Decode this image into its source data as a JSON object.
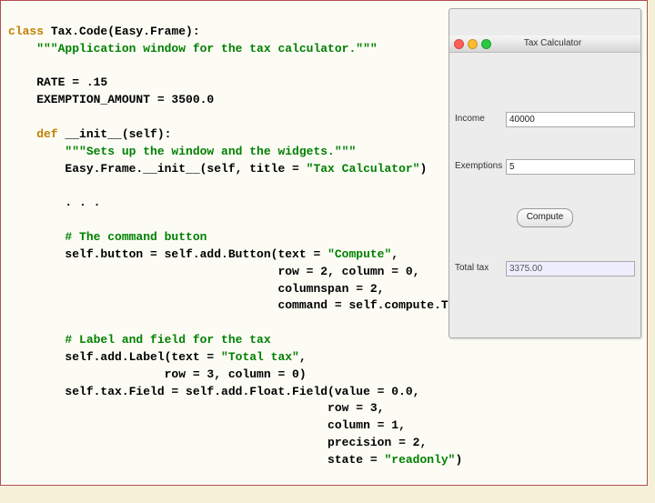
{
  "code": {
    "l1a": "class",
    "l1b": " Tax.Code(Easy.Frame):",
    "l2": "    \"\"\"Application window for the tax calculator.\"\"\"",
    "l3": "",
    "l4": "    RATE = .15",
    "l5": "    EXEMPTION_AMOUNT = 3500.0",
    "l6": "",
    "l7a": "    def",
    "l7b": " __init__(self):",
    "l8": "        \"\"\"Sets up the window and the widgets.\"\"\"",
    "l9a": "        Easy.Frame.__init__(self, title = ",
    "l9b": "\"Tax Calculator\"",
    "l9c": ")",
    "l10": "",
    "l11": "        . . .",
    "l12": "",
    "l13": "        # The command button",
    "l14a": "        self.button = self.add.Button(text = ",
    "l14b": "\"Compute\"",
    "l14c": ",",
    "l15": "                                      row = 2, column = 0,",
    "l16": "                                      columnspan = 2,",
    "l17": "                                      command = self.compute.Tax)",
    "l18": "",
    "l19": "        # Label and field for the tax",
    "l20a": "        self.add.Label(text = ",
    "l20b": "\"Total tax\"",
    "l20c": ",",
    "l21": "                      row = 3, column = 0)",
    "l22": "        self.tax.Field = self.add.Float.Field(value = 0.0,",
    "l23": "                                             row = 3,",
    "l24": "                                             column = 1,",
    "l25": "                                             precision = 2,",
    "l26a": "                                             state = ",
    "l26b": "\"readonly\"",
    "l26c": ")"
  },
  "window": {
    "title": "Tax Calculator",
    "rows": {
      "income_label": "Income",
      "income_value": "40000",
      "exemptions_label": "Exemptions",
      "exemptions_value": "5",
      "compute_button": "Compute",
      "totaltax_label": "Total tax",
      "totaltax_value": "3375.00"
    }
  }
}
